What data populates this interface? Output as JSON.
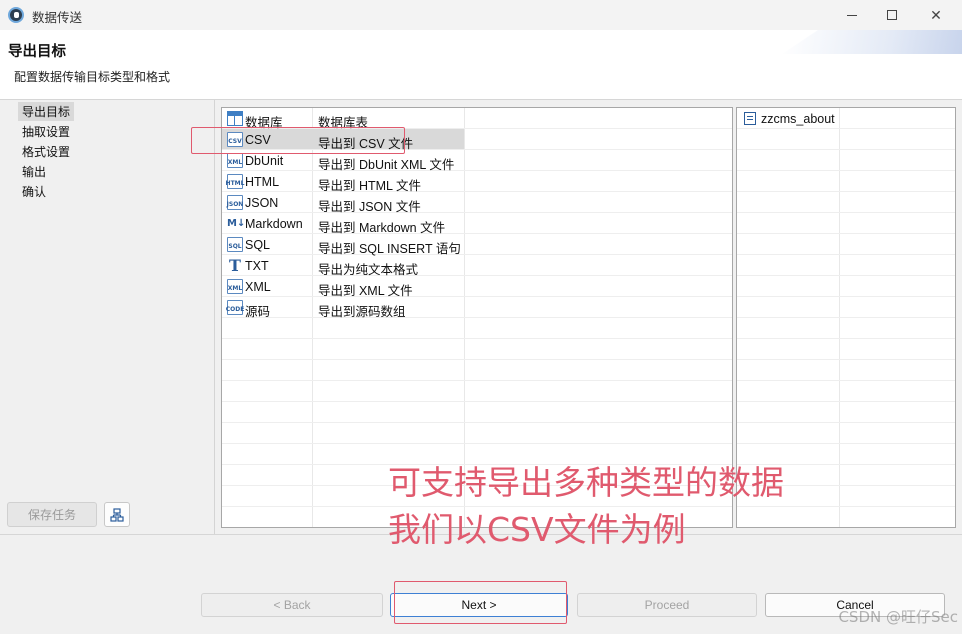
{
  "window": {
    "title": "数据传送"
  },
  "header": {
    "title": "导出目标",
    "subtitle": "配置数据传输目标类型和格式"
  },
  "nav": {
    "items": [
      {
        "label": "导出目标",
        "active": true
      },
      {
        "label": "抽取设置",
        "active": false
      },
      {
        "label": "格式设置",
        "active": false
      },
      {
        "label": "输出",
        "active": false
      },
      {
        "label": "确认",
        "active": false
      }
    ],
    "save_task_label": "保存任务",
    "tree_icon": "tree-icon"
  },
  "formats": [
    {
      "icon": "table-icon",
      "type": "数据库",
      "desc": "数据库表",
      "selected": false
    },
    {
      "icon": "csv-icon",
      "type": "CSV",
      "desc": "导出到 CSV 文件",
      "selected": true
    },
    {
      "icon": "xml-icon",
      "type": "DbUnit",
      "desc": "导出到 DbUnit XML 文件",
      "selected": false
    },
    {
      "icon": "html-icon",
      "type": "HTML",
      "desc": "导出到 HTML 文件",
      "selected": false
    },
    {
      "icon": "json-icon",
      "type": "JSON",
      "desc": "导出到 JSON 文件",
      "selected": false
    },
    {
      "icon": "markdown-icon",
      "type": "Markdown",
      "desc": "导出到 Markdown 文件",
      "selected": false
    },
    {
      "icon": "sql-icon",
      "type": "SQL",
      "desc": "导出到 SQL INSERT 语句",
      "selected": false
    },
    {
      "icon": "text-icon",
      "type": "TXT",
      "desc": "导出为纯文本格式",
      "selected": false
    },
    {
      "icon": "xml-icon",
      "type": "XML",
      "desc": "导出到 XML 文件",
      "selected": false
    },
    {
      "icon": "code-icon",
      "type": "源码",
      "desc": "导出到源码数组",
      "selected": false
    }
  ],
  "icon_labels": {
    "csv": "CSV",
    "xml": "XML",
    "html": "HTML",
    "json": "JSON",
    "sql": "SQL",
    "code": "CODE",
    "markdown": "M↓",
    "text": "T"
  },
  "source_tables": [
    {
      "icon": "table-doc-icon",
      "name": "zzcms_about"
    }
  ],
  "buttons": {
    "back": "< Back",
    "next": "Next >",
    "proceed": "Proceed",
    "cancel": "Cancel"
  },
  "annotation": {
    "line1": "可支持导出多种类型的数据",
    "line2": "我们以CSV文件为例",
    "color": "#e05a6e"
  },
  "watermark": "CSDN @旺仔Sec"
}
